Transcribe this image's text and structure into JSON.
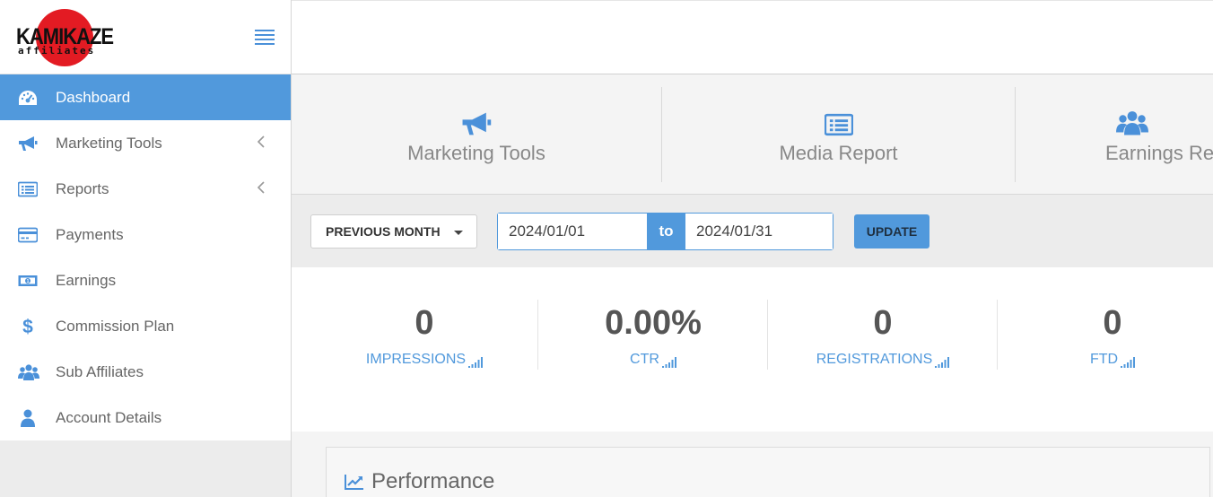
{
  "brand": {
    "logo_line1": "KAMIKAZE",
    "logo_line2": "affiliates",
    "colors": {
      "sun": "#e31b23",
      "accent": "#5199dc"
    }
  },
  "sidebar": {
    "items": [
      {
        "label": "Dashboard",
        "icon": "dashboard-gauge-icon",
        "active": true
      },
      {
        "label": "Marketing Tools",
        "icon": "megaphone-icon",
        "has_submenu": true
      },
      {
        "label": "Reports",
        "icon": "list-report-icon",
        "has_submenu": true
      },
      {
        "label": "Payments",
        "icon": "credit-card-icon"
      },
      {
        "label": "Earnings",
        "icon": "money-bill-icon"
      },
      {
        "label": "Commission Plan",
        "icon": "dollar-sign-icon"
      },
      {
        "label": "Sub Affiliates",
        "icon": "users-icon"
      },
      {
        "label": "Account Details",
        "icon": "user-icon"
      }
    ]
  },
  "quicknav": [
    {
      "label": "Marketing Tools",
      "icon": "megaphone-icon"
    },
    {
      "label": "Media Report",
      "icon": "list-report-icon"
    },
    {
      "label": "Earnings Rep",
      "icon": "users-icon"
    }
  ],
  "filter": {
    "period": "PREVIOUS MONTH",
    "date_from": "2024/01/01",
    "to_label": "to",
    "date_to": "2024/01/31",
    "update_label": "UPDATE"
  },
  "stats": [
    {
      "value": "0",
      "label": "IMPRESSIONS"
    },
    {
      "value": "0.00%",
      "label": "CTR"
    },
    {
      "value": "0",
      "label": "REGISTRATIONS"
    },
    {
      "value": "0",
      "label": "FTD"
    }
  ],
  "performance": {
    "title": "Performance",
    "icon": "line-chart-icon"
  }
}
